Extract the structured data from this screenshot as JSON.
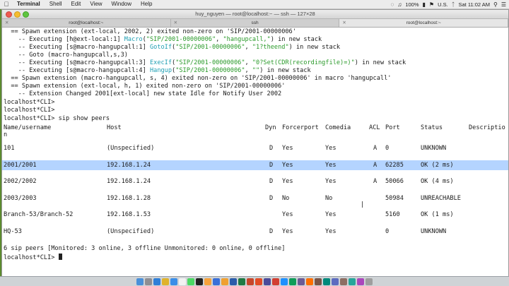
{
  "menubar": {
    "apple": "",
    "items": [
      "Terminal",
      "Shell",
      "Edit",
      "View",
      "Window",
      "Help"
    ],
    "status": {
      "battery": "100%",
      "input_source": "U.S.",
      "clock": "Sat 11:02 AM"
    }
  },
  "window": {
    "title": "huy_nguyen — root@localhost:~ — ssh — 127×28",
    "tabs": [
      "root@localhost:~",
      "ssh",
      "root@localhost:~"
    ]
  },
  "log": [
    {
      "plain": "  == Spawn extension (ext-local, 2002, 2) exited non-zero on 'SIP/2001-00000006'"
    },
    {
      "pre": "    -- Executing [h@ext-local:1] ",
      "kw": "Macro",
      "mid": "(",
      "s1": "\"SIP/2001-00000006\"",
      "mid2": ", ",
      "s2": "\"hangupcall,\"",
      "post": ") in new stack"
    },
    {
      "pre": "    -- Executing [s@macro-hangupcall:1] ",
      "kw": "GotoIf",
      "mid": "(",
      "s1": "\"SIP/2001-00000006\"",
      "mid2": ", ",
      "s2": "\"1?theend\"",
      "post": ") in new stack"
    },
    {
      "plain": "    -- Goto (macro-hangupcall,s,3)"
    },
    {
      "pre": "    -- Executing [s@macro-hangupcall:3] ",
      "kw": "ExecIf",
      "mid": "(",
      "s1": "\"SIP/2001-00000006\"",
      "mid2": ", ",
      "s2": "\"0?Set(CDR(recordingfile)=)\"",
      "post": ") in new stack"
    },
    {
      "pre": "    -- Executing [s@macro-hangupcall:4] ",
      "kw": "Hangup",
      "mid": "(",
      "s1": "\"SIP/2001-00000006\"",
      "mid2": ", ",
      "s2": "\"\"",
      "post": ") in new stack"
    },
    {
      "plain": "  == Spawn extension (macro-hangupcall, s, 4) exited non-zero on 'SIP/2001-00000006' in macro 'hangupcall'"
    },
    {
      "plain": "  == Spawn extension (ext-local, h, 1) exited non-zero on 'SIP/2001-00000006'"
    },
    {
      "plain": "    -- Extension Changed 2001[ext-local] new state Idle for Notify User 2002"
    },
    {
      "plain": "localhost*CLI>"
    },
    {
      "plain": "localhost*CLI>"
    },
    {
      "plain": "localhost*CLI> sip show peers"
    }
  ],
  "peers": {
    "headers": {
      "name": "Name/username",
      "host": "Host",
      "dyn": "Dyn",
      "forcerport": "Forcerport",
      "comedia": "Comedia",
      "acl": "ACL",
      "port": "Port",
      "status": "Status",
      "description": "Descriptio",
      "wrap": "n"
    },
    "rows": [
      {
        "name": "101",
        "host": "(Unspecified)",
        "dyn": "D",
        "forcerport": "Yes",
        "comedia": "Yes",
        "acl": "A",
        "port": "0",
        "status": "UNKNOWN"
      },
      {
        "name": "2001/2001",
        "host": "192.168.1.24",
        "dyn": "D",
        "forcerport": "Yes",
        "comedia": "Yes",
        "acl": "A",
        "port": "62285",
        "status": "OK (2 ms)"
      },
      {
        "name": "2002/2002",
        "host": "192.168.1.24",
        "dyn": "D",
        "forcerport": "Yes",
        "comedia": "Yes",
        "acl": "A",
        "port": "50066",
        "status": "OK (4 ms)"
      },
      {
        "name": "2003/2003",
        "host": "192.168.1.28",
        "dyn": "D",
        "forcerport": "No",
        "comedia": "No",
        "acl": "",
        "port": "50984",
        "status": "UNREACHABLE"
      },
      {
        "name": "Branch-53/Branch-52",
        "host": "192.168.1.53",
        "dyn": "",
        "forcerport": "Yes",
        "comedia": "Yes",
        "acl": "",
        "port": "5160",
        "status": "OK (1 ms)"
      },
      {
        "name": "HQ-53",
        "host": "(Unspecified)",
        "dyn": "D",
        "forcerport": "Yes",
        "comedia": "Yes",
        "acl": "",
        "port": "0",
        "status": "UNKNOWN"
      }
    ],
    "summary": "6 sip peers [Monitored: 3 online, 3 offline Unmonitored: 0 online, 0 offline]",
    "prompt": "localhost*CLI> "
  },
  "dock": {
    "icons": [
      "finder-icon",
      "launchpad-icon",
      "safari-icon",
      "chrome-icon",
      "mail-icon",
      "calendar-icon",
      "messages-icon",
      "terminal-icon",
      "photos-icon",
      "keynote-icon",
      "pages-icon",
      "word-icon",
      "excel-icon",
      "powerpoint-icon",
      "app-icon",
      "app-icon",
      "app-icon",
      "app-icon",
      "app-icon",
      "app-icon",
      "app-icon",
      "app-icon",
      "app-icon",
      "app-icon",
      "app-icon",
      "app-icon",
      "app-icon",
      "trash-icon"
    ],
    "colors": [
      "#4a90d9",
      "#8e8e93",
      "#2f7fd8",
      "#e0b22c",
      "#3b8ee8",
      "#f2f2f2",
      "#4cd964",
      "#222222",
      "#f7a23b",
      "#3a6fd8",
      "#f0a030",
      "#2b5caa",
      "#1f7a44",
      "#c8462b",
      "#e34c26",
      "#4b4b9b",
      "#d23f31",
      "#1e90ff",
      "#0f9d58",
      "#6b5b95",
      "#ff6f00",
      "#795548",
      "#00897b",
      "#5c6bc0",
      "#8d6e63",
      "#26a69a",
      "#ab47bc",
      "#9e9e9e"
    ]
  }
}
